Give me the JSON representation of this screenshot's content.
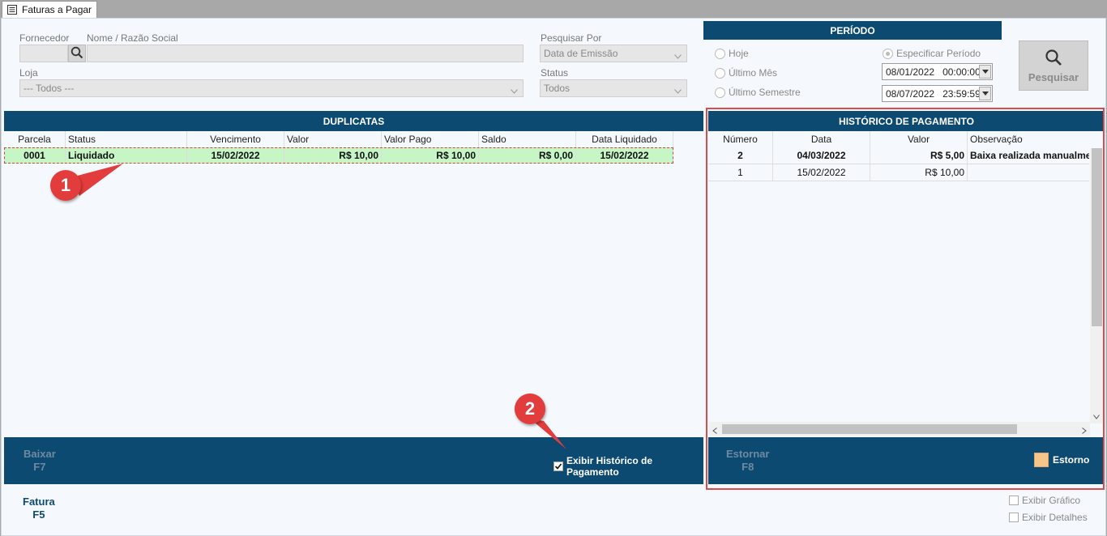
{
  "tab": {
    "title": "Faturas a Pagar",
    "icon": "list-icon"
  },
  "filters": {
    "fornecedor_label": "Fornecedor",
    "nome_label": "Nome / Razão Social",
    "loja_label": "Loja",
    "loja_value": "--- Todos ---",
    "pesquisar_por_label": "Pesquisar Por",
    "pesquisar_por_value": "Data de Emissão",
    "status_label": "Status",
    "status_value": "Todos"
  },
  "periodo": {
    "title": "PERÍODO",
    "hoje": "Hoje",
    "ultimo_mes": "Último Mês",
    "ultimo_semestre": "Último Semestre",
    "especificar": "Especificar Período",
    "date_from": "08/01/2022",
    "time_from": "00:00:00",
    "date_to": "08/07/2022",
    "time_to": "23:59:59"
  },
  "search_button": {
    "label": "Pesquisar"
  },
  "duplicatas": {
    "title": "DUPLICATAS",
    "columns": [
      "Parcela",
      "Status",
      "Vencimento",
      "Valor",
      "Valor Pago",
      "Saldo",
      "Data Liquidado"
    ],
    "rows": [
      {
        "parcela": "0001",
        "status": "Liquidado",
        "vencimento": "15/02/2022",
        "valor": "R$ 10,00",
        "valor_pago": "R$ 10,00",
        "saldo": "R$ 0,00",
        "data_liquidado": "15/02/2022"
      }
    ]
  },
  "historico": {
    "title": "HISTÓRICO DE PAGAMENTO",
    "columns": [
      "Número",
      "Data",
      "Valor",
      "Observação"
    ],
    "rows": [
      {
        "numero": "2",
        "data": "04/03/2022",
        "valor": "R$ 5,00",
        "observacao": "Baixa realizada manualmen"
      },
      {
        "numero": "1",
        "data": "15/02/2022",
        "valor": "R$ 10,00",
        "observacao": ""
      }
    ]
  },
  "left_bar": {
    "baixar_label": "Baixar",
    "baixar_key": "F7",
    "exibir_historico": "Exibir Histórico de Pagamento"
  },
  "right_bar": {
    "estornar_label": "Estornar",
    "estornar_key": "F8",
    "estorno_legend": "Estorno",
    "estorno_color": "#f5c58a"
  },
  "footer": {
    "fatura_label": "Fatura",
    "fatura_key": "F5",
    "exibir_grafico": "Exibir Gráfico",
    "exibir_detalhes": "Exibir Detalhes"
  },
  "annotations": {
    "badge1": "1",
    "badge2": "2"
  },
  "colors": {
    "header_blue": "#0d4a72",
    "selected_row": "#c6f5c6",
    "highlight_red": "#d94c4c"
  }
}
